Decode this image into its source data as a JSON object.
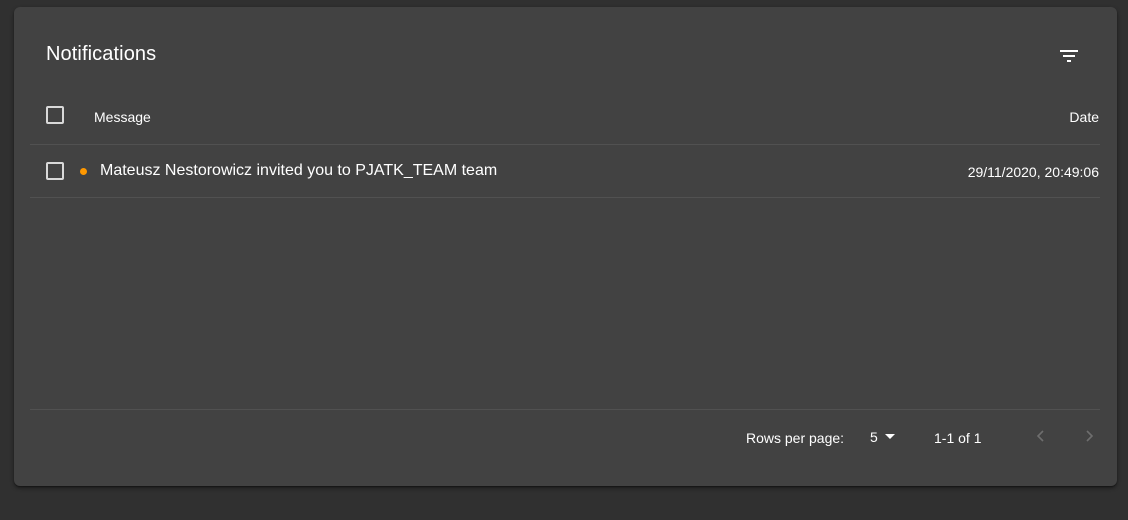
{
  "notifications": {
    "title": "Notifications",
    "filter_icon": "filter-list-icon",
    "columns": {
      "message": "Message",
      "date": "Date"
    },
    "rows": [
      {
        "unread": true,
        "message": "Mateusz Nestorowicz invited you to PJATK_TEAM team",
        "date": "29/11/2020, 20:49:06"
      }
    ],
    "pagination": {
      "rows_per_page_label": "Rows per page:",
      "rows_per_page_value": "5",
      "range": "1-1 of 1",
      "prev_icon": "chevron-left-icon",
      "next_icon": "chevron-right-icon"
    }
  },
  "colors": {
    "background": "#303030",
    "card": "#424242",
    "unread_dot": "#ff9800",
    "divider": "#515151"
  }
}
